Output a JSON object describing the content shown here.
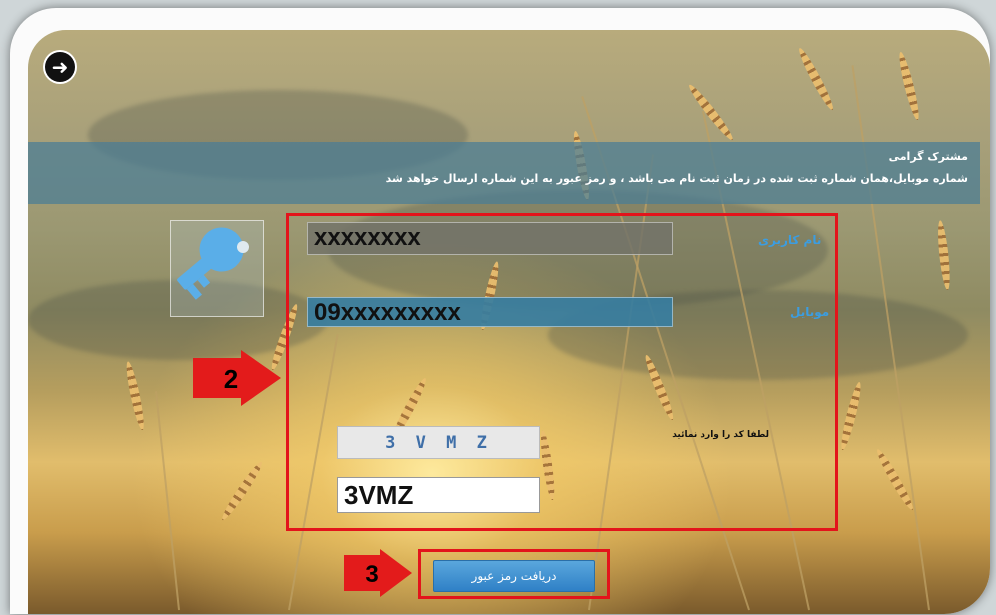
{
  "header": {
    "greeting": "مشترک گرامی",
    "message": "شماره موبایل،همان شماره ثبت شده در زمان ثبت نام می باشد ، و رمز عبور به این شماره ارسال خواهد شد"
  },
  "form": {
    "username_label": "نام کاربری",
    "username_value": "xxxxxxxx",
    "mobile_label": "موبایل",
    "mobile_value": "09xxxxxxxxx",
    "captcha_hint": "لطفا کد را وارد نمائید",
    "captcha_image_text": "3 V M Z",
    "captcha_value": "3VMZ",
    "submit_label": "دریافت رمز عبور"
  },
  "annotations": {
    "step2": "2",
    "step3": "3"
  },
  "colors": {
    "header_band": "#4a7d96",
    "label_blue": "#3c9de0",
    "highlight_red": "#e3141b",
    "button_blue": "#2f80c6"
  },
  "icons": {
    "back": "back-arrow-icon",
    "key": "key-icon"
  }
}
